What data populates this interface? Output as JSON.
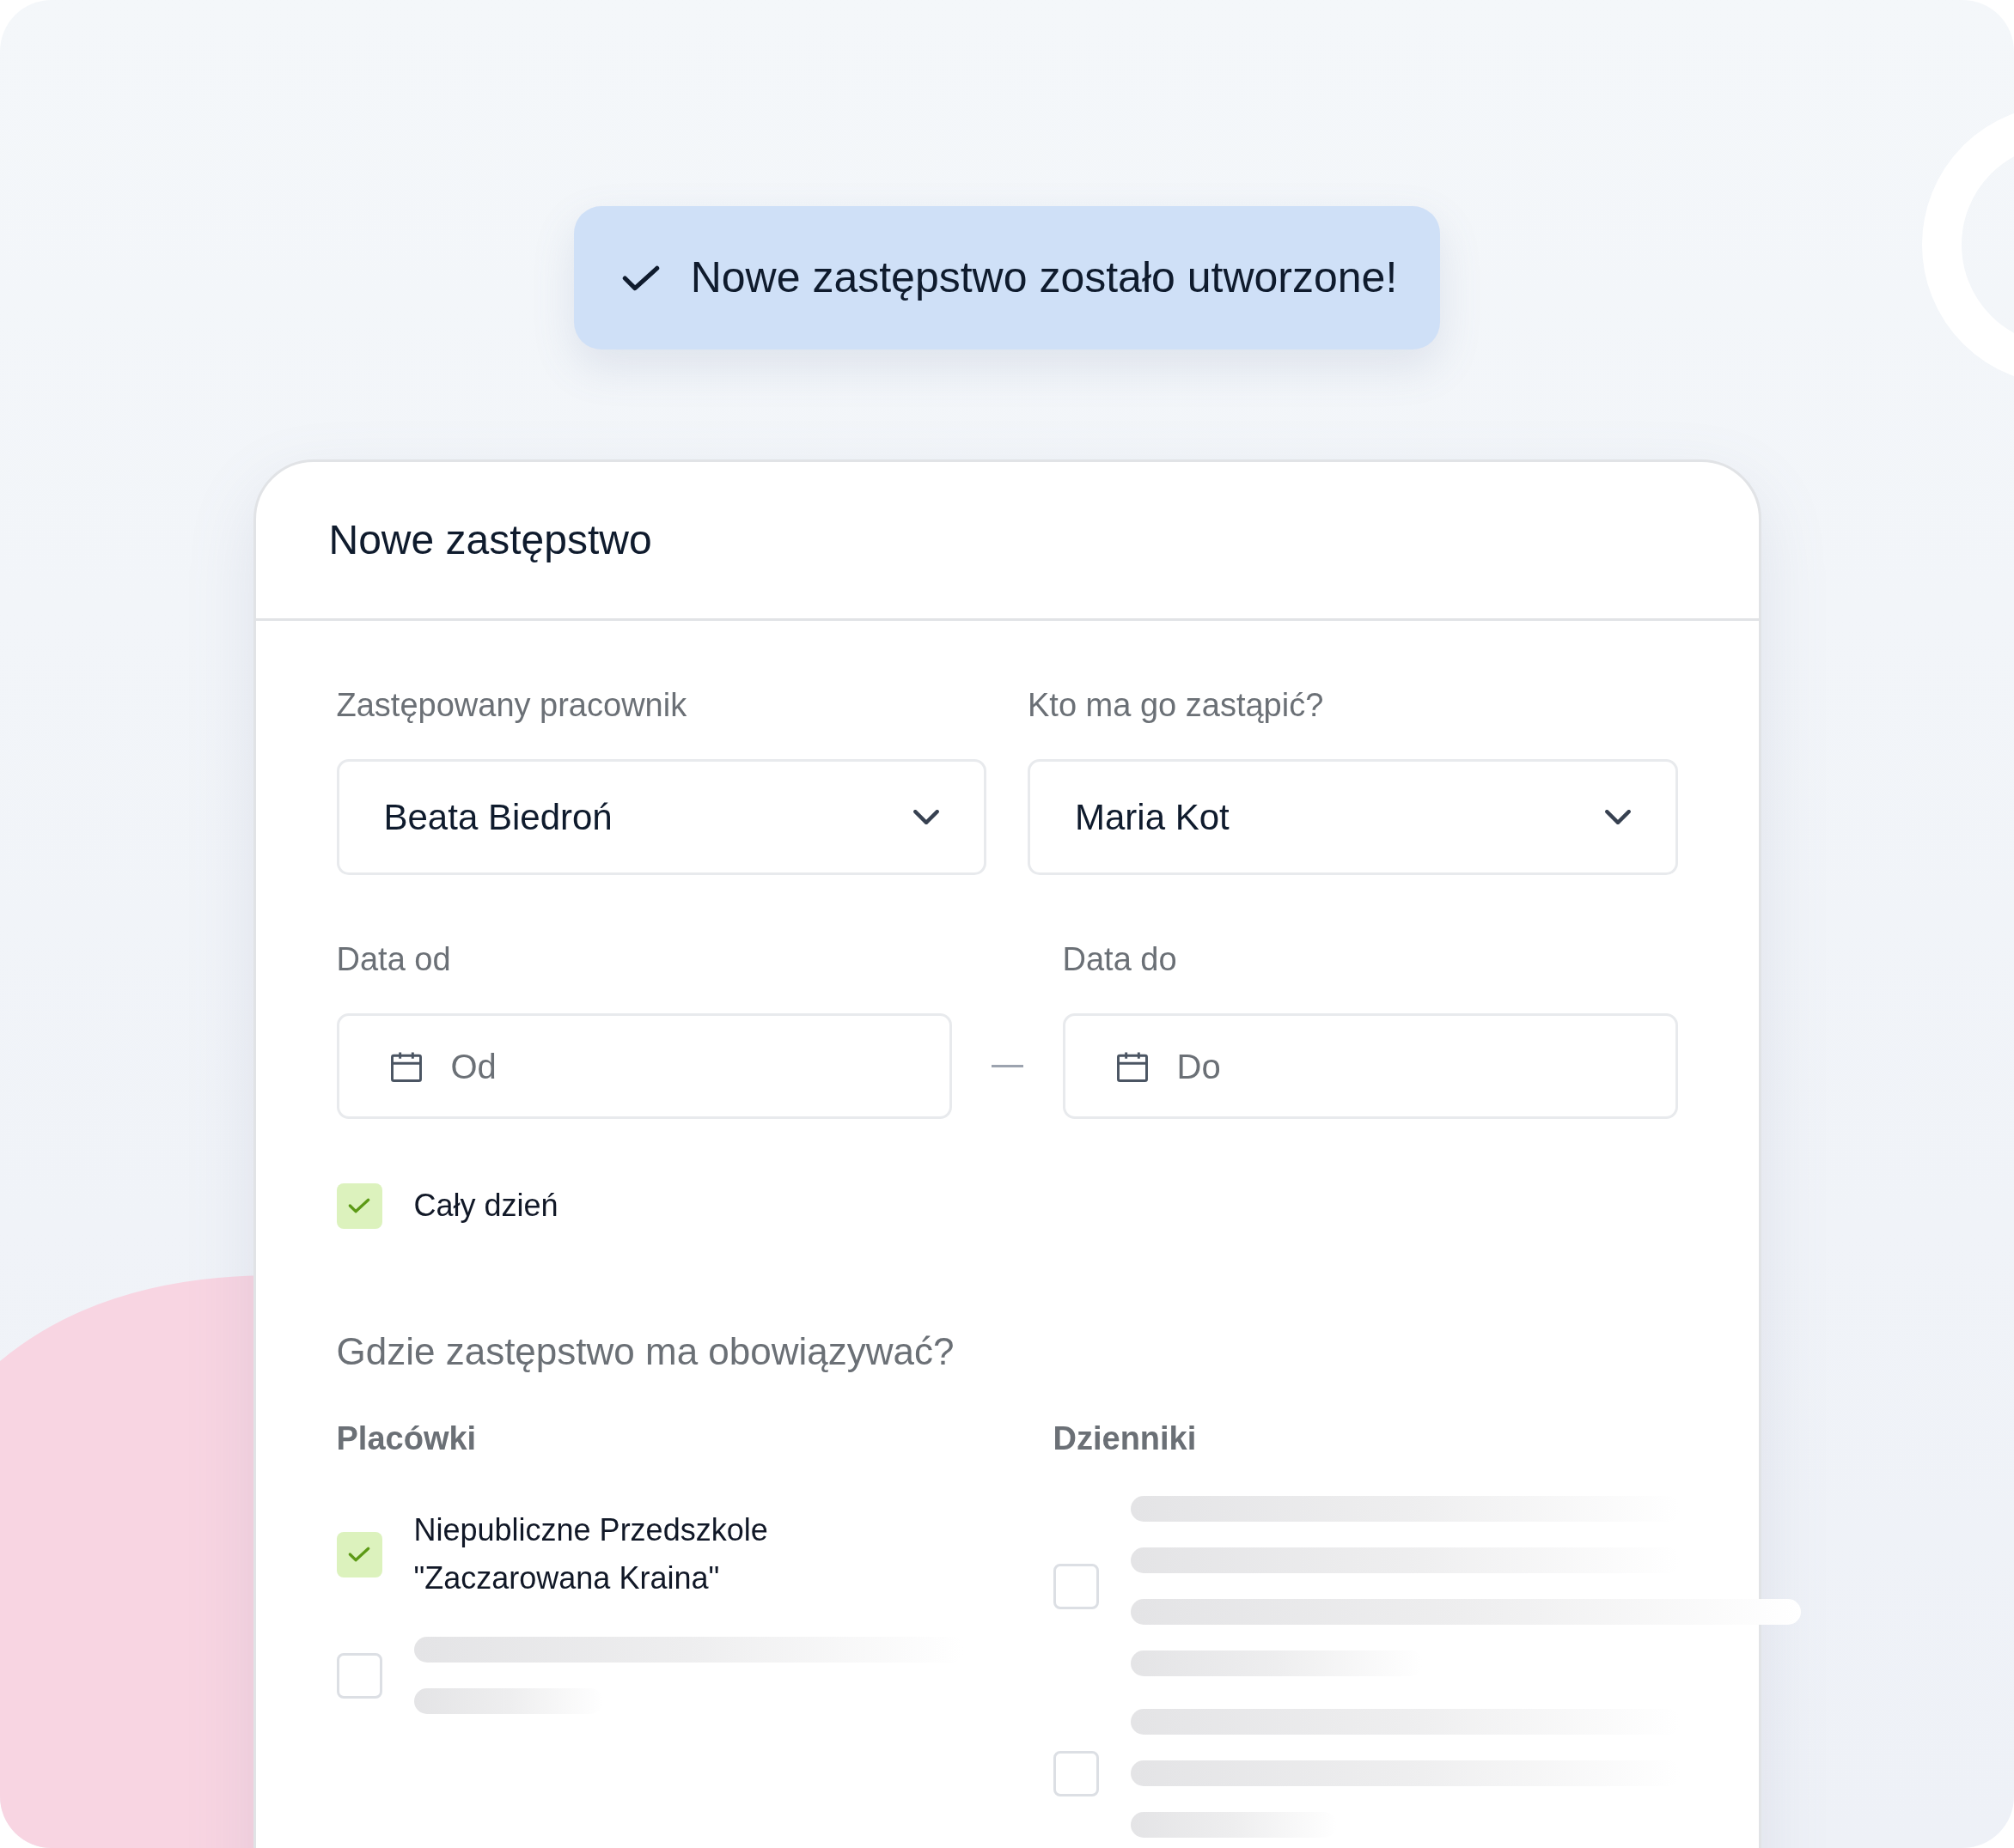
{
  "toast": {
    "message": "Nowe zastępstwo zostało utworzone!"
  },
  "form": {
    "title": "Nowe zastępstwo",
    "selects": [
      {
        "label": "Zastępowany pracownik",
        "value": "Beata Biedroń"
      },
      {
        "label": "Kto ma go zastąpić?",
        "value": "Maria Kot"
      }
    ],
    "dates": [
      {
        "label": "Data od",
        "placeholder": "Od"
      },
      {
        "label": "Data do",
        "placeholder": "Do"
      }
    ],
    "all_day": {
      "label": "Cały dzień",
      "checked": true
    },
    "scope_question": "Gdzie zastępstwo ma obowiązywać?",
    "facilities": {
      "heading": "Placówki",
      "items": [
        {
          "kind": "text",
          "label": "Niepubliczne Przedszkole \"Zaczarowana Kraina\"",
          "checked": true
        },
        {
          "kind": "skeleton",
          "checked": false
        }
      ]
    },
    "journals": {
      "heading": "Dzienniki",
      "items": [
        {
          "kind": "skeleton",
          "checked": false
        },
        {
          "kind": "skeleton",
          "checked": false
        }
      ]
    }
  }
}
